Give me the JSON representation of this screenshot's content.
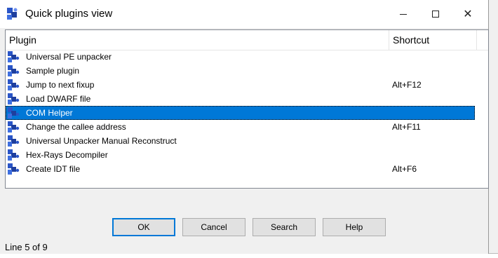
{
  "window": {
    "title": "Quick plugins view",
    "icon": "puzzle-icon"
  },
  "list": {
    "columns": {
      "plugin": "Plugin",
      "shortcut": "Shortcut"
    },
    "rows": [
      {
        "name": "Universal PE unpacker",
        "shortcut": ""
      },
      {
        "name": "Sample plugin",
        "shortcut": ""
      },
      {
        "name": "Jump to next fixup",
        "shortcut": "Alt+F12"
      },
      {
        "name": "Load DWARF file",
        "shortcut": ""
      },
      {
        "name": "COM Helper",
        "shortcut": ""
      },
      {
        "name": "Change the callee address",
        "shortcut": "Alt+F11"
      },
      {
        "name": "Universal Unpacker Manual Reconstruct",
        "shortcut": ""
      },
      {
        "name": "Hex-Rays Decompiler",
        "shortcut": ""
      },
      {
        "name": "Create IDT file",
        "shortcut": "Alt+F6"
      }
    ],
    "selected_index": 4
  },
  "buttons": {
    "ok": "OK",
    "cancel": "Cancel",
    "search": "Search",
    "help": "Help"
  },
  "status": "Line 5 of 9",
  "colors": {
    "selection": "#0078d7",
    "default_button_border": "#0078d7"
  }
}
